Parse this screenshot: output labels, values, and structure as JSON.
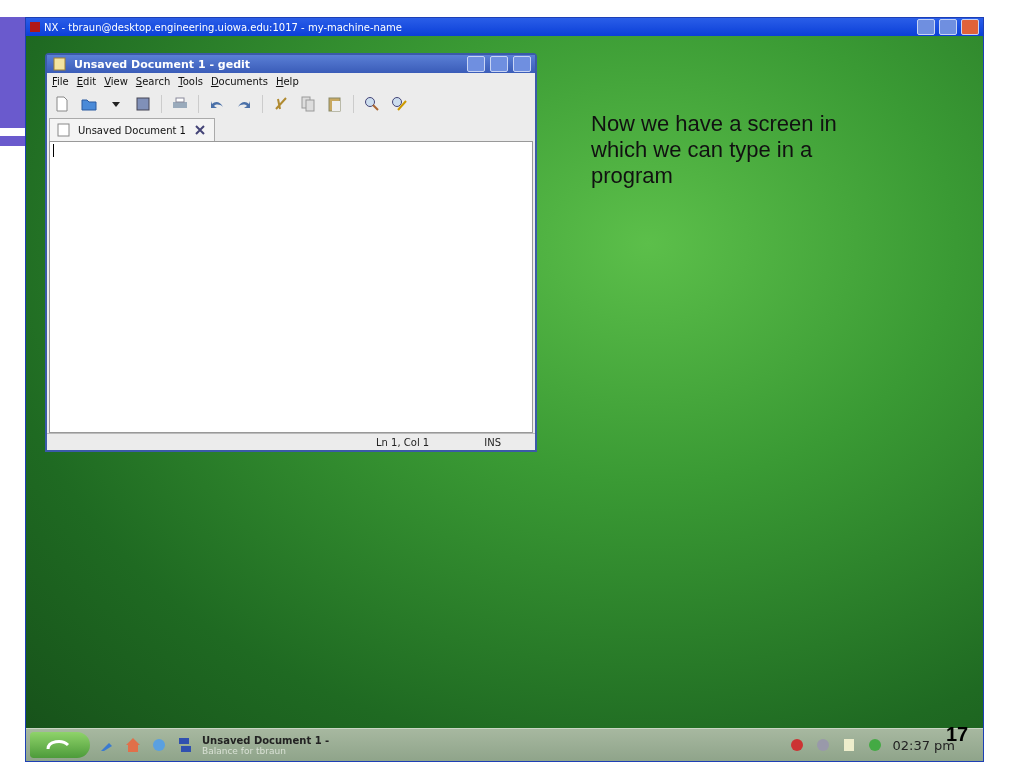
{
  "slide": {
    "caption": "Now we have a screen in which we can type in a program",
    "page_number": "17"
  },
  "nx_window": {
    "title": "NX - tbraun@desktop.engineering.uiowa.edu:1017 - my-machine-name"
  },
  "gedit": {
    "title": "Unsaved Document 1 - gedit",
    "menu": [
      "File",
      "Edit",
      "View",
      "Search",
      "Tools",
      "Documents",
      "Help"
    ],
    "tab": "Unsaved Document 1",
    "status": {
      "position": "Ln 1, Col 1",
      "mode": "INS"
    }
  },
  "taskbar": {
    "task_title": "Unsaved Document 1 -",
    "task_subtitle": "Balance for tbraun",
    "clock": "02:37 pm"
  }
}
